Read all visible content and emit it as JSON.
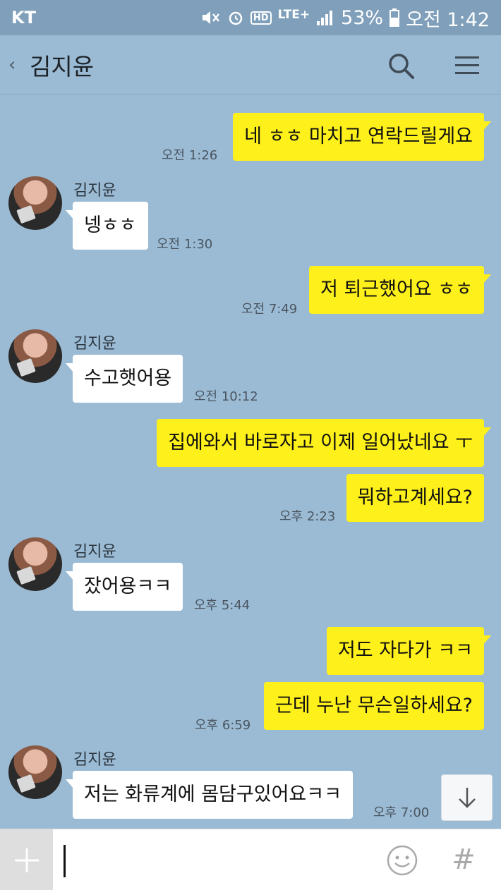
{
  "status_bar": {
    "carrier": "KT",
    "lte": "LTE+",
    "hd": "HD",
    "battery": "53%",
    "time": "오전 1:42"
  },
  "header": {
    "back_symbol": "‹",
    "title": "김지윤",
    "icons": [
      "search-icon",
      "menu-icon"
    ]
  },
  "messages": [
    {
      "from": "me",
      "text": "네 ㅎㅎ 마치고 연락드릴게요",
      "time": "오전 1:26"
    },
    {
      "from": "them",
      "sender": "김지윤",
      "text": "넹ㅎㅎ",
      "time": "오전 1:30"
    },
    {
      "from": "me",
      "text": "저 퇴근했어요 ㅎㅎ",
      "time": "오전 7:49"
    },
    {
      "from": "them",
      "sender": "김지윤",
      "text": "수고햇어용",
      "time": "오전 10:12"
    },
    {
      "from": "me",
      "text": "집에와서 바로자고 이제 일어났네요 ㅜ",
      "time": ""
    },
    {
      "from": "me",
      "text": "뭐하고계세요?",
      "time": "오후 2:23"
    },
    {
      "from": "them",
      "sender": "김지윤",
      "text": "잤어용ㅋㅋ",
      "time": "오후 5:44"
    },
    {
      "from": "me",
      "text": "저도 자다가 ㅋㅋ",
      "time": ""
    },
    {
      "from": "me",
      "text": "근데 누난 무슨일하세요?",
      "time": "오후 6:59"
    },
    {
      "from": "them",
      "sender": "김지윤",
      "text": "저는 화류계에 몸담구있어요ㅋㅋ",
      "time": "오후 7:00"
    }
  ],
  "input": {
    "placeholder": "",
    "plus_symbol": "+",
    "hash_symbol": "#"
  },
  "colors": {
    "background": "#9bbbd4",
    "my_bubble": "#fef01b",
    "their_bubble": "#ffffff",
    "status_bar": "#7f9fbb"
  }
}
